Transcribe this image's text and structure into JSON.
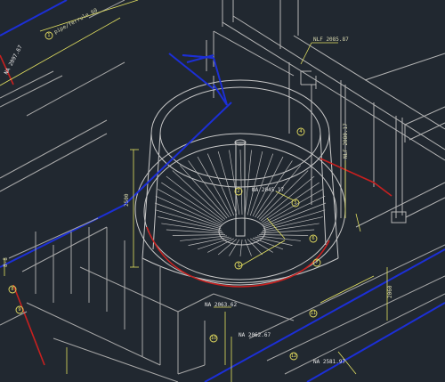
{
  "drawing": {
    "background": "#212830",
    "colors": {
      "structure": "#b5b5b5",
      "pipe_blue": "#1c2fd6",
      "pipe_red": "#c8201f",
      "leader_yellow": "#e3e160",
      "bubble": "#e8e060"
    },
    "annotations": {
      "nlf_top": "NLF 2085.87",
      "nlf_right": "NLF 2080.17",
      "na_center": "NA 2045.17",
      "na_bottom1": "NA 2063.62",
      "na_bottom2": "NA 2062.67",
      "na_bottom3": "NA 2581.97",
      "na_left": "NA 2097.67",
      "pipe_left": "pipe/ferrule 60",
      "dim_left": "8-8",
      "dim_mid": "2500",
      "dim_bot": "2060"
    },
    "bubbles": [
      "1",
      "2",
      "3",
      "4",
      "5",
      "6",
      "7",
      "8",
      "9",
      "10",
      "11",
      "12"
    ]
  }
}
